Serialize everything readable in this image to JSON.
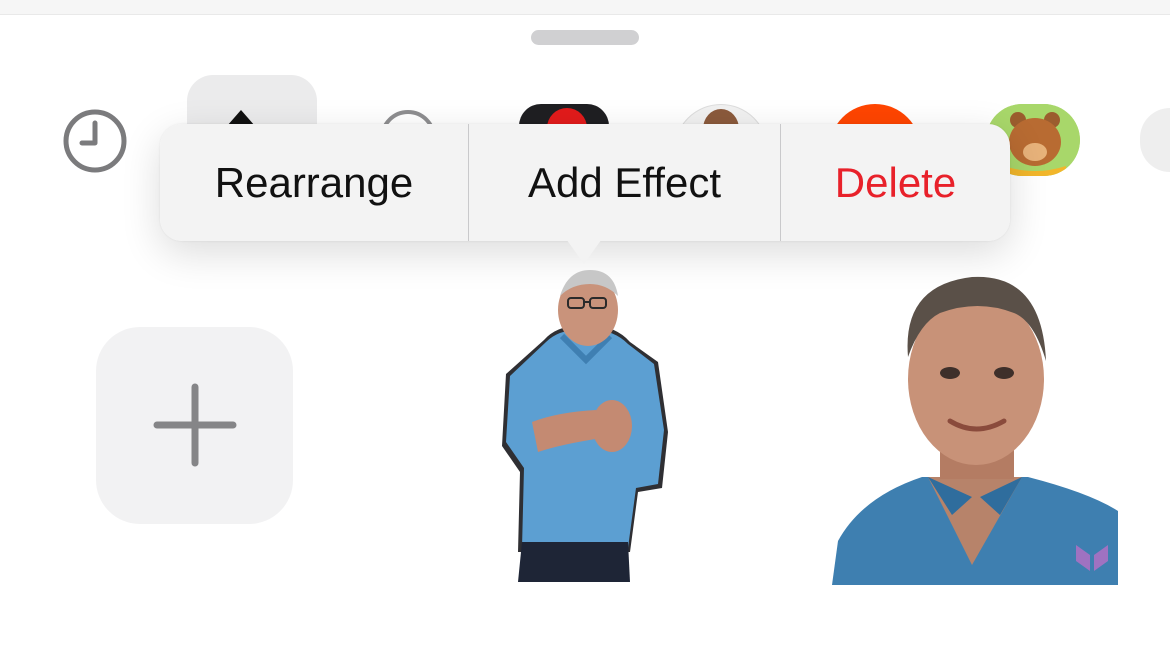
{
  "context_menu": {
    "items": [
      {
        "label": "Rearrange"
      },
      {
        "label": "Add Effect"
      },
      {
        "label": "Delete",
        "color": "#e8212a"
      }
    ]
  },
  "tray": {
    "icons": [
      "recents-clock-icon",
      "sticker-send-icon",
      "circle-icon",
      "app-icon-dark",
      "memoji-icon",
      "app-icon-orange",
      "bear-app-icon"
    ],
    "selected": "sticker-send-icon"
  },
  "stickers": [
    {
      "name": "sticker-man-blue-polo"
    },
    {
      "name": "sticker-man-blue-shirt"
    }
  ],
  "add_sticker": {
    "icon": "plus-icon"
  },
  "colors": {
    "accent_destructive": "#e8212a",
    "menu_bg": "#f3f3f3",
    "tile_bg": "#f2f2f3"
  }
}
